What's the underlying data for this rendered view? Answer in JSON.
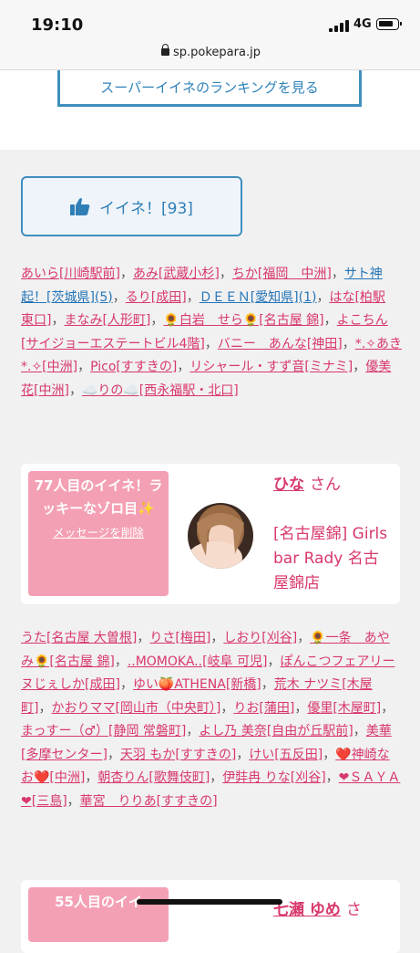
{
  "status": {
    "time": "19:10",
    "network": "4G"
  },
  "browser": {
    "url": "sp.pokepara.jp"
  },
  "ranking_link": "スーパーイイネのランキングを見る",
  "like_button": {
    "label": "イイネ！[93]"
  },
  "list1": [
    {
      "text": "あいら[川崎駅前]",
      "color": "pink"
    },
    {
      "text": "あみ[武蔵小杉]",
      "color": "pink"
    },
    {
      "text": "ちか[福岡　中洲]",
      "color": "pink"
    },
    {
      "text": "サト神起！[茨城県](5)",
      "color": "blue"
    },
    {
      "text": "るり[成田]",
      "color": "pink"
    },
    {
      "text": "ＤＥＥＮ[愛知県](1)",
      "color": "blue"
    },
    {
      "text": "はな[柏駅 東口]",
      "color": "pink"
    },
    {
      "text": "まなみ[人形町]",
      "color": "pink"
    },
    {
      "text": "🌻白岩　せら🌻[名古屋 錦]",
      "color": "pink"
    },
    {
      "text": "よこちん[サイジョーエステートビル4階]",
      "color": "pink"
    },
    {
      "text": "バニー　あんな[神田]",
      "color": "pink"
    },
    {
      "text": "*.✧あき*.✧[中洲]",
      "color": "pink"
    },
    {
      "text": "Pico[すすきの]",
      "color": "pink"
    },
    {
      "text": "リシャール・すず音[ミナミ]",
      "color": "pink"
    },
    {
      "text": "優美花[中洲]",
      "color": "pink"
    },
    {
      "text": "☁️りの☁️[西永福駅・北口]",
      "color": "pink"
    }
  ],
  "card1": {
    "badge_text": "77人目のイイネ！ラッキーなゾロ目✨",
    "delete_label": "メッセージを削除",
    "name": "ひな",
    "honorific": "さん",
    "shop": "[名古屋錦] Girls bar Rady 名古屋錦店"
  },
  "list2": [
    {
      "text": "うた[名古屋 大曽根]",
      "color": "pink"
    },
    {
      "text": "りさ[梅田]",
      "color": "pink"
    },
    {
      "text": "しおり[刈谷]",
      "color": "pink"
    },
    {
      "text": "🌻一条　あやみ🌻[名古屋 錦]",
      "color": "pink"
    },
    {
      "text": "..MOMOKA..[岐阜 可児]",
      "color": "pink"
    },
    {
      "text": "ぽんこつフェアリーヌじぇしか[成田]",
      "color": "pink"
    },
    {
      "text": "ゆい🍑ATHENA[新橋]",
      "color": "pink"
    },
    {
      "text": "荒木 ナツミ[木屋町]",
      "color": "pink"
    },
    {
      "text": "かおりママ[岡山市（中央町）]",
      "color": "pink"
    },
    {
      "text": "りお[蒲田]",
      "color": "pink"
    },
    {
      "text": "優里[木屋町]",
      "color": "pink"
    },
    {
      "text": "まっすー（♂）[静岡 常磐町]",
      "color": "pink"
    },
    {
      "text": "よし乃 美奈[自由が丘駅前]",
      "color": "pink"
    },
    {
      "text": "美華[多摩センター]",
      "color": "pink"
    },
    {
      "text": "天羽 もか[すすきの]",
      "color": "pink"
    },
    {
      "text": "けい[五反田]",
      "color": "pink"
    },
    {
      "text": "❤️神崎なお❤️[中洲]",
      "color": "pink"
    },
    {
      "text": "朝杏りん[歌舞伎町]",
      "color": "pink"
    },
    {
      "text": "伊弉冉 りな[刈谷]",
      "color": "pink"
    },
    {
      "text": "❤ＳＡＹＡ❤[三島]",
      "color": "pink"
    },
    {
      "text": "華宮　りりあ[すすきの]",
      "color": "pink"
    }
  ],
  "card2": {
    "badge_text": "55人目のイイ",
    "name": "七瀬 ゆめ",
    "honorific": "さ"
  }
}
